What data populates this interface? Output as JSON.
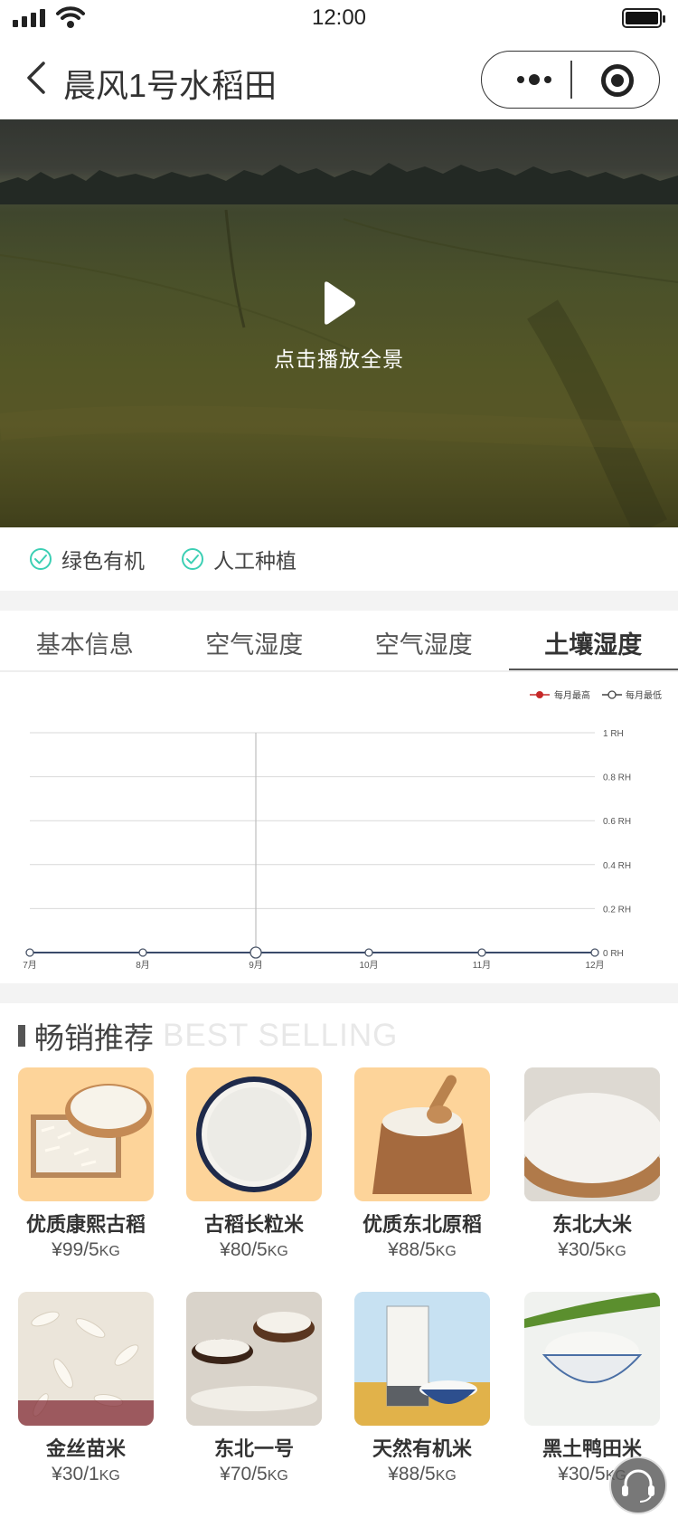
{
  "status_bar": {
    "time": "12:00"
  },
  "nav": {
    "title": "晨风1号水稻田"
  },
  "hero": {
    "play_text": "点击播放全景"
  },
  "tags": [
    "绿色有机",
    "人工种植"
  ],
  "tabs": [
    {
      "label": "基本信息",
      "active": false
    },
    {
      "label": "空气湿度",
      "active": false
    },
    {
      "label": "空气湿度",
      "active": false
    },
    {
      "label": "土壤湿度",
      "active": true
    }
  ],
  "chart_data": {
    "type": "line",
    "categories": [
      "7月",
      "8月",
      "9月",
      "10月",
      "11月",
      "12月"
    ],
    "series": [
      {
        "name": "每月最高",
        "values": [
          0,
          0,
          0,
          0,
          0,
          0
        ],
        "color": "#c62828"
      },
      {
        "name": "每月最低",
        "values": [
          0,
          0,
          0,
          0,
          0,
          0
        ],
        "color": "#3a4a6a"
      }
    ],
    "y_ticks": [
      "1 RH",
      "0.8 RH",
      "0.6 RH",
      "0.4 RH",
      "0.2 RH",
      "0 RH"
    ],
    "ylim": [
      0,
      1
    ],
    "highlight_index": 2,
    "legend_position": "top-right",
    "grid": true
  },
  "section": {
    "title_cn": "畅销推荐",
    "title_en": "BEST SELLING"
  },
  "products": [
    {
      "name": "优质康熙古稻",
      "price": "¥99/5",
      "unit": "KG",
      "visual": "rice-crate"
    },
    {
      "name": "古稻长粒米",
      "price": "¥80/5",
      "unit": "KG",
      "visual": "rice-plate"
    },
    {
      "name": "优质东北原稻",
      "price": "¥88/5",
      "unit": "KG",
      "visual": "rice-sack"
    },
    {
      "name": "东北大米",
      "price": "¥30/5",
      "unit": "KG",
      "visual": "rice-bowl"
    },
    {
      "name": "金丝苗米",
      "price": "¥30/1",
      "unit": "KG",
      "visual": "rice-closeup"
    },
    {
      "name": "东北一号",
      "price": "¥70/5",
      "unit": "KG",
      "visual": "rice-wood-bowls"
    },
    {
      "name": "天然有机米",
      "price": "¥88/5",
      "unit": "KG",
      "visual": "rice-package"
    },
    {
      "name": "黑土鸭田米",
      "price": "¥30/5",
      "unit": "KG",
      "visual": "rice-porcelain"
    }
  ],
  "colors": {
    "check": "#3ccfb4",
    "accent": "#555555",
    "divider": "#f3f3f3"
  }
}
